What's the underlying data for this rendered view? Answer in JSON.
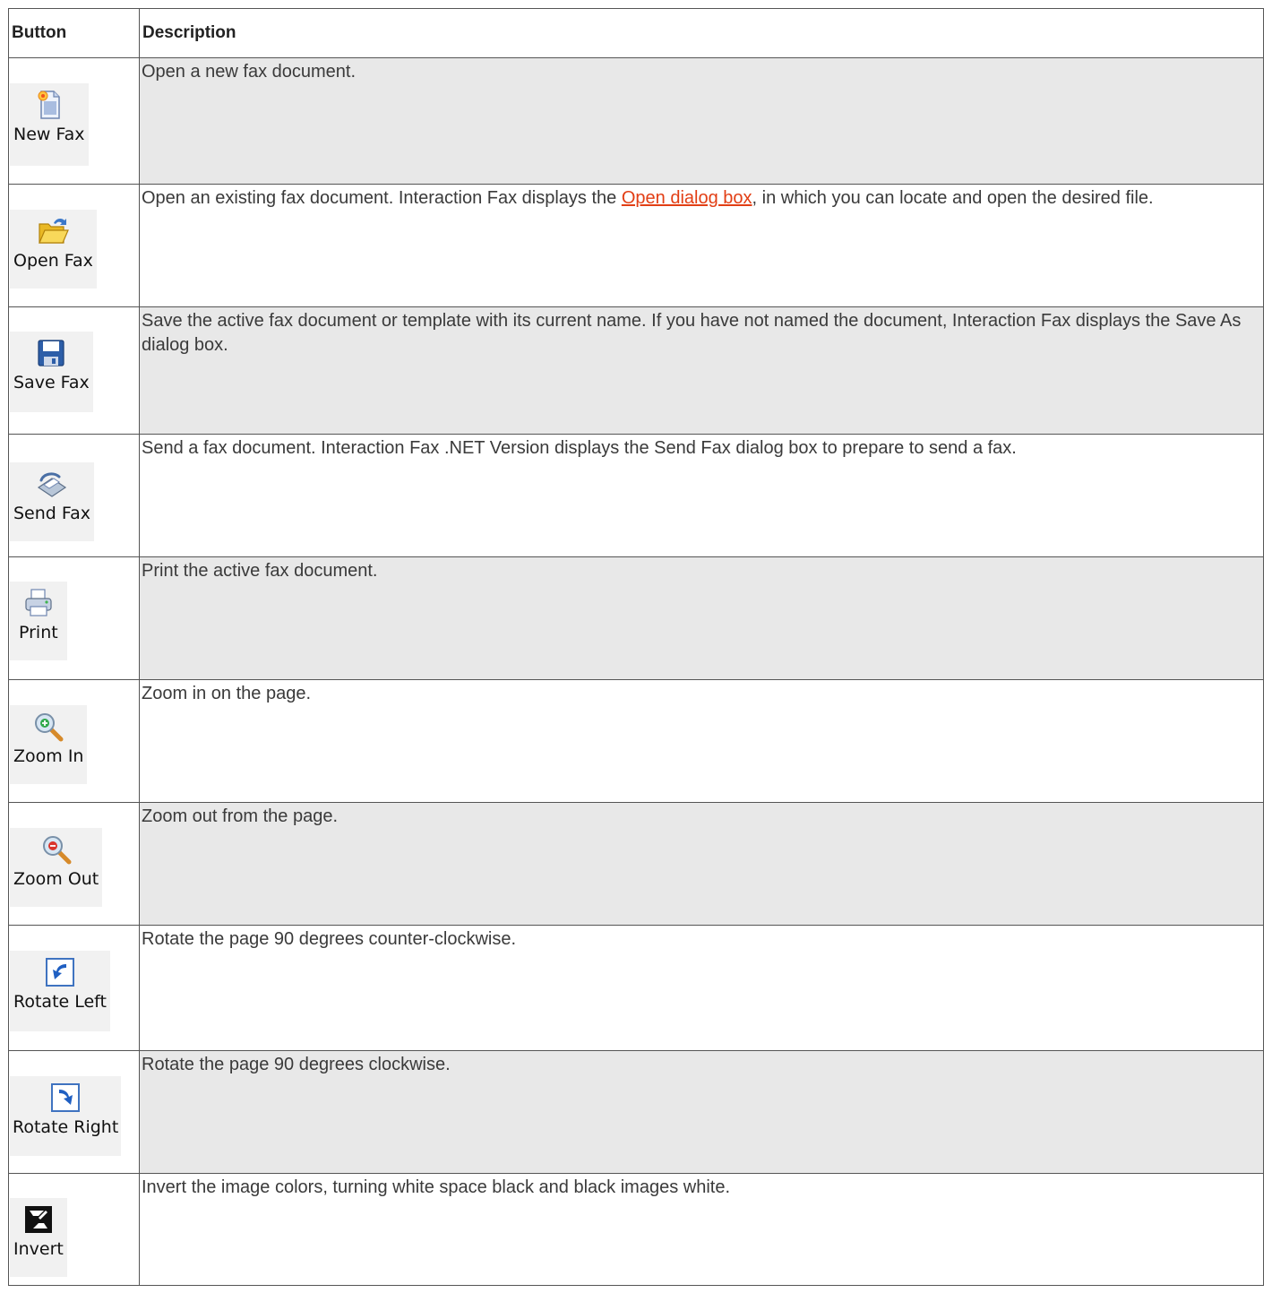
{
  "table": {
    "headers": [
      "Button",
      "Description"
    ],
    "rows": [
      {
        "label": "New Fax",
        "icon": "new-fax-icon",
        "description": "Open a new fax document."
      },
      {
        "label": "Open Fax",
        "icon": "open-fax-icon",
        "description_before": "Open an existing fax document. Interaction Fax displays the ",
        "link": "Open dialog box",
        "description_after": ", in which you can locate and open the desired file."
      },
      {
        "label": "Save Fax",
        "icon": "save-fax-icon",
        "description": "Save the active fax document or template with its current name. If you have not named the document, Interaction Fax displays the Save As dialog box."
      },
      {
        "label": "Send Fax",
        "icon": "send-fax-icon",
        "description": "Send a fax document. Interaction Fax .NET Version displays the Send Fax dialog box to prepare to send a fax."
      },
      {
        "label": "Print",
        "icon": "print-icon",
        "description": "Print the active fax document."
      },
      {
        "label": "Zoom In",
        "icon": "zoom-in-icon",
        "description": "Zoom in on the page."
      },
      {
        "label": "Zoom Out",
        "icon": "zoom-out-icon",
        "description": "Zoom out from the page."
      },
      {
        "label": "Rotate Left",
        "icon": "rotate-left-icon",
        "description": "Rotate the page 90 degrees counter-clockwise."
      },
      {
        "label": "Rotate Right",
        "icon": "rotate-right-icon",
        "description": "Rotate the page 90 degrees clockwise."
      },
      {
        "label": "Invert",
        "icon": "invert-icon",
        "description": "Invert the image colors, turning white space black and black images white."
      }
    ]
  },
  "colors": {
    "link": "#e23e14",
    "row_shade": "#e8e8e8",
    "border": "#555555"
  }
}
